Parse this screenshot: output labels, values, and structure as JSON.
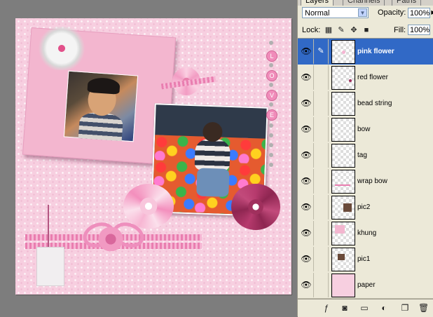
{
  "panel": {
    "tabs": [
      "Layers",
      "Channels",
      "Paths"
    ],
    "blend_mode": "Normal",
    "opacity_label": "Opacity:",
    "opacity_value": "100%",
    "lock_label": "Lock:",
    "fill_label": "Fill:",
    "fill_value": "100%",
    "layers": [
      {
        "name": "pink flower",
        "selected": true
      },
      {
        "name": "red flower",
        "selected": false
      },
      {
        "name": "bead string",
        "selected": false
      },
      {
        "name": "bow",
        "selected": false
      },
      {
        "name": "tag",
        "selected": false
      },
      {
        "name": "wrap bow",
        "selected": false
      },
      {
        "name": "pic2",
        "selected": false
      },
      {
        "name": "khung",
        "selected": false
      },
      {
        "name": "pic1",
        "selected": false
      },
      {
        "name": "paper",
        "selected": false
      }
    ],
    "bottom_icons": [
      "link-icon",
      "layer-style-icon",
      "mask-icon",
      "folder-icon",
      "adjustment-icon",
      "new-layer-icon",
      "trash-icon"
    ]
  },
  "canvas": {
    "beads": [
      "L",
      "O",
      "V",
      "E"
    ],
    "colors": {
      "paper": "#f7cfe0",
      "frame": "#f3b6cf",
      "selection": "#3169c6"
    }
  }
}
